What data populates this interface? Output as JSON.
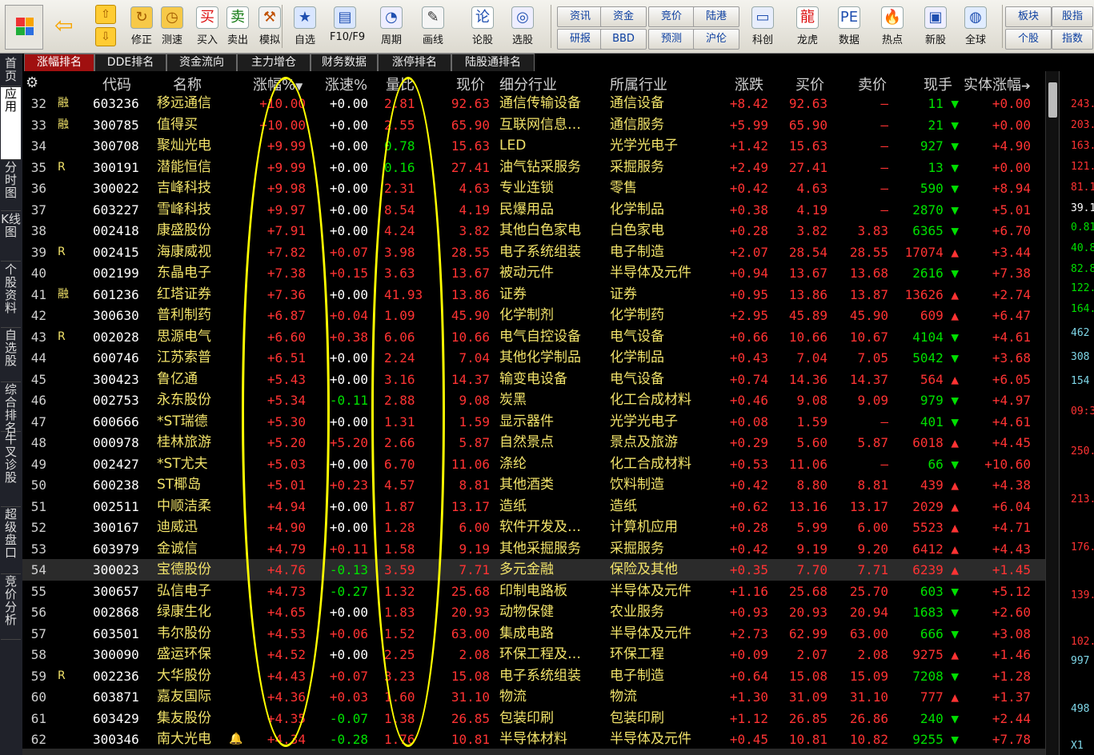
{
  "toolbar": {
    "buttons": [
      {
        "label": "修正",
        "icon": "refresh-icon"
      },
      {
        "label": "测速",
        "icon": "clock-icon"
      },
      {
        "label": "买入",
        "icon": "buy-icon"
      },
      {
        "label": "卖出",
        "icon": "sell-icon"
      },
      {
        "label": "模拟",
        "icon": "hammer-icon"
      },
      {
        "label": "自选",
        "icon": "star-icon"
      },
      {
        "label": "F10/F9",
        "icon": "f10-icon"
      },
      {
        "label": "周期",
        "icon": "cycle-icon"
      },
      {
        "label": "画线",
        "icon": "pencil-icon"
      },
      {
        "label": "论股",
        "icon": "discuss-icon"
      },
      {
        "label": "选股",
        "icon": "select-icon"
      },
      {
        "label": "科创",
        "icon": "chart-icon"
      },
      {
        "label": "龙虎",
        "icon": "dragon-icon"
      },
      {
        "label": "数据",
        "icon": "pe-icon"
      },
      {
        "label": "热点",
        "icon": "hot-icon"
      },
      {
        "label": "新股",
        "icon": "new-icon"
      },
      {
        "label": "全球",
        "icon": "globe-icon"
      }
    ],
    "small_buttons": [
      "资讯",
      "研报",
      "资金",
      "BBD",
      "竞价",
      "预测",
      "陆港",
      "沪伦",
      "板块",
      "个股",
      "股指",
      "指数"
    ]
  },
  "tabs": [
    "涨幅排名",
    "DDE排名",
    "资金流向",
    "主力增仓",
    "财务数据",
    "涨停排名",
    "陆股通排名"
  ],
  "leftbar": [
    "首页",
    "应用",
    "分时图",
    "K线图",
    "个股资料",
    "自选股",
    "综合排名",
    "牛叉诊股",
    "超级盘口",
    "竞价分析"
  ],
  "headers": [
    "",
    "代码",
    "名称",
    "涨幅%",
    "涨速%",
    "量比",
    "现价",
    "细分行业",
    "所属行业",
    "涨跌",
    "买价",
    "卖价",
    "现手",
    "实体涨幅"
  ],
  "rows": [
    {
      "no": "32",
      "flag": "融",
      "code": "603236",
      "name": "移远通信",
      "chg": "+10.00",
      "speed": "+0.00",
      "vol": "2.81",
      "price": "92.63",
      "sub": "通信传输设备",
      "ind": "通信设备",
      "diff": "+8.42",
      "bid": "92.63",
      "ask": "–",
      "hand": "11",
      "dir": "down",
      "body": "+0.00"
    },
    {
      "no": "33",
      "flag": "融",
      "code": "300785",
      "name": "值得买",
      "chg": "+10.00",
      "speed": "+0.00",
      "vol": "2.55",
      "price": "65.90",
      "sub": "互联网信息…",
      "ind": "通信服务",
      "diff": "+5.99",
      "bid": "65.90",
      "ask": "–",
      "hand": "21",
      "dir": "down",
      "body": "+0.00"
    },
    {
      "no": "34",
      "flag": "",
      "code": "300708",
      "name": "聚灿光电",
      "chg": "+9.99",
      "speed": "+0.00",
      "vol": "0.78",
      "price": "15.63",
      "sub": "LED",
      "ind": "光学光电子",
      "diff": "+1.42",
      "bid": "15.63",
      "ask": "–",
      "hand": "927",
      "dir": "down",
      "body": "+4.90"
    },
    {
      "no": "35",
      "flag": "R",
      "code": "300191",
      "name": "潜能恒信",
      "chg": "+9.99",
      "speed": "+0.00",
      "vol": "0.16",
      "price": "27.41",
      "sub": "油气钻采服务",
      "ind": "采掘服务",
      "diff": "+2.49",
      "bid": "27.41",
      "ask": "–",
      "hand": "13",
      "dir": "down",
      "body": "+0.00"
    },
    {
      "no": "36",
      "flag": "",
      "code": "300022",
      "name": "吉峰科技",
      "chg": "+9.98",
      "speed": "+0.00",
      "vol": "2.31",
      "price": "4.63",
      "sub": "专业连锁",
      "ind": "零售",
      "diff": "+0.42",
      "bid": "4.63",
      "ask": "–",
      "hand": "590",
      "dir": "down",
      "body": "+8.94"
    },
    {
      "no": "37",
      "flag": "",
      "code": "603227",
      "name": "雪峰科技",
      "chg": "+9.97",
      "speed": "+0.00",
      "vol": "8.54",
      "price": "4.19",
      "sub": "民爆用品",
      "ind": "化学制品",
      "diff": "+0.38",
      "bid": "4.19",
      "ask": "–",
      "hand": "2870",
      "dir": "down",
      "body": "+5.01"
    },
    {
      "no": "38",
      "flag": "",
      "code": "002418",
      "name": "康盛股份",
      "chg": "+7.91",
      "speed": "+0.00",
      "vol": "4.24",
      "price": "3.82",
      "sub": "其他白色家电",
      "ind": "白色家电",
      "diff": "+0.28",
      "bid": "3.82",
      "ask": "3.83",
      "hand": "6365",
      "dir": "down",
      "body": "+6.70"
    },
    {
      "no": "39",
      "flag": "R",
      "code": "002415",
      "name": "海康威视",
      "chg": "+7.82",
      "speed": "+0.07",
      "vol": "3.98",
      "price": "28.55",
      "sub": "电子系统组装",
      "ind": "电子制造",
      "diff": "+2.07",
      "bid": "28.54",
      "ask": "28.55",
      "hand": "17074",
      "dir": "up",
      "body": "+3.44"
    },
    {
      "no": "40",
      "flag": "",
      "code": "002199",
      "name": "东晶电子",
      "chg": "+7.38",
      "speed": "+0.15",
      "vol": "3.63",
      "price": "13.67",
      "sub": "被动元件",
      "ind": "半导体及元件",
      "diff": "+0.94",
      "bid": "13.67",
      "ask": "13.68",
      "hand": "2616",
      "dir": "down",
      "body": "+7.38"
    },
    {
      "no": "41",
      "flag": "融",
      "code": "601236",
      "name": "红塔证券",
      "chg": "+7.36",
      "speed": "+0.00",
      "vol": "41.93",
      "price": "13.86",
      "sub": "证券",
      "ind": "证券",
      "diff": "+0.95",
      "bid": "13.86",
      "ask": "13.87",
      "hand": "13626",
      "dir": "up",
      "body": "+2.74"
    },
    {
      "no": "42",
      "flag": "",
      "code": "300630",
      "name": "普利制药",
      "chg": "+6.87",
      "speed": "+0.04",
      "vol": "1.09",
      "price": "45.90",
      "sub": "化学制剂",
      "ind": "化学制药",
      "diff": "+2.95",
      "bid": "45.89",
      "ask": "45.90",
      "hand": "609",
      "dir": "up",
      "body": "+6.47"
    },
    {
      "no": "43",
      "flag": "R",
      "code": "002028",
      "name": "思源电气",
      "chg": "+6.60",
      "speed": "+0.38",
      "vol": "6.06",
      "price": "10.66",
      "sub": "电气自控设备",
      "ind": "电气设备",
      "diff": "+0.66",
      "bid": "10.66",
      "ask": "10.67",
      "hand": "4104",
      "dir": "down",
      "body": "+4.61"
    },
    {
      "no": "44",
      "flag": "",
      "code": "600746",
      "name": "江苏索普",
      "chg": "+6.51",
      "speed": "+0.00",
      "vol": "2.24",
      "price": "7.04",
      "sub": "其他化学制品",
      "ind": "化学制品",
      "diff": "+0.43",
      "bid": "7.04",
      "ask": "7.05",
      "hand": "5042",
      "dir": "down",
      "body": "+3.68"
    },
    {
      "no": "45",
      "flag": "",
      "code": "300423",
      "name": "鲁亿通",
      "chg": "+5.43",
      "speed": "+0.00",
      "vol": "3.16",
      "price": "14.37",
      "sub": "输变电设备",
      "ind": "电气设备",
      "diff": "+0.74",
      "bid": "14.36",
      "ask": "14.37",
      "hand": "564",
      "dir": "up",
      "body": "+6.05"
    },
    {
      "no": "46",
      "flag": "",
      "code": "002753",
      "name": "永东股份",
      "chg": "+5.34",
      "speed": "-0.11",
      "vol": "2.88",
      "price": "9.08",
      "sub": "炭黑",
      "ind": "化工合成材料",
      "diff": "+0.46",
      "bid": "9.08",
      "ask": "9.09",
      "hand": "979",
      "dir": "down",
      "body": "+4.97"
    },
    {
      "no": "47",
      "flag": "",
      "code": "600666",
      "name": "*ST瑞德",
      "chg": "+5.30",
      "speed": "+0.00",
      "vol": "1.31",
      "price": "1.59",
      "sub": "显示器件",
      "ind": "光学光电子",
      "diff": "+0.08",
      "bid": "1.59",
      "ask": "–",
      "hand": "401",
      "dir": "down",
      "body": "+4.61"
    },
    {
      "no": "48",
      "flag": "",
      "code": "000978",
      "name": "桂林旅游",
      "chg": "+5.20",
      "speed": "+5.20",
      "vol": "2.66",
      "price": "5.87",
      "sub": "自然景点",
      "ind": "景点及旅游",
      "diff": "+0.29",
      "bid": "5.60",
      "ask": "5.87",
      "hand": "6018",
      "dir": "up",
      "body": "+4.45"
    },
    {
      "no": "49",
      "flag": "",
      "code": "002427",
      "name": "*ST尤夫",
      "chg": "+5.03",
      "speed": "+0.00",
      "vol": "6.70",
      "price": "11.06",
      "sub": "涤纶",
      "ind": "化工合成材料",
      "diff": "+0.53",
      "bid": "11.06",
      "ask": "–",
      "hand": "66",
      "dir": "down",
      "body": "+10.60"
    },
    {
      "no": "50",
      "flag": "",
      "code": "600238",
      "name": "ST椰岛",
      "chg": "+5.01",
      "speed": "+0.23",
      "vol": "4.57",
      "price": "8.81",
      "sub": "其他酒类",
      "ind": "饮料制造",
      "diff": "+0.42",
      "bid": "8.80",
      "ask": "8.81",
      "hand": "439",
      "dir": "up",
      "body": "+4.38"
    },
    {
      "no": "51",
      "flag": "",
      "code": "002511",
      "name": "中顺洁柔",
      "chg": "+4.94",
      "speed": "+0.00",
      "vol": "1.87",
      "price": "13.17",
      "sub": "造纸",
      "ind": "造纸",
      "diff": "+0.62",
      "bid": "13.16",
      "ask": "13.17",
      "hand": "2029",
      "dir": "up",
      "body": "+6.04"
    },
    {
      "no": "52",
      "flag": "",
      "code": "300167",
      "name": "迪威迅",
      "chg": "+4.90",
      "speed": "+0.00",
      "vol": "1.28",
      "price": "6.00",
      "sub": "软件开发及…",
      "ind": "计算机应用",
      "diff": "+0.28",
      "bid": "5.99",
      "ask": "6.00",
      "hand": "5523",
      "dir": "up",
      "body": "+4.71"
    },
    {
      "no": "53",
      "flag": "",
      "code": "603979",
      "name": "金诚信",
      "chg": "+4.79",
      "speed": "+0.11",
      "vol": "1.58",
      "price": "9.19",
      "sub": "其他采掘服务",
      "ind": "采掘服务",
      "diff": "+0.42",
      "bid": "9.19",
      "ask": "9.20",
      "hand": "6412",
      "dir": "up",
      "body": "+4.43"
    },
    {
      "no": "54",
      "flag": "",
      "code": "300023",
      "name": "宝德股份",
      "chg": "+4.76",
      "speed": "-0.13",
      "vol": "3.59",
      "price": "7.71",
      "sub": "多元金融",
      "ind": "保险及其他",
      "diff": "+0.35",
      "bid": "7.70",
      "ask": "7.71",
      "hand": "6239",
      "dir": "up",
      "body": "+1.45"
    },
    {
      "no": "55",
      "flag": "",
      "code": "300657",
      "name": "弘信电子",
      "chg": "+4.73",
      "speed": "-0.27",
      "vol": "1.32",
      "price": "25.68",
      "sub": "印制电路板",
      "ind": "半导体及元件",
      "diff": "+1.16",
      "bid": "25.68",
      "ask": "25.70",
      "hand": "603",
      "dir": "down",
      "body": "+5.12"
    },
    {
      "no": "56",
      "flag": "",
      "code": "002868",
      "name": "绿康生化",
      "chg": "+4.65",
      "speed": "+0.00",
      "vol": "1.83",
      "price": "20.93",
      "sub": "动物保健",
      "ind": "农业服务",
      "diff": "+0.93",
      "bid": "20.93",
      "ask": "20.94",
      "hand": "1683",
      "dir": "down",
      "body": "+2.60"
    },
    {
      "no": "57",
      "flag": "",
      "code": "603501",
      "name": "韦尔股份",
      "chg": "+4.53",
      "speed": "+0.06",
      "vol": "1.52",
      "price": "63.00",
      "sub": "集成电路",
      "ind": "半导体及元件",
      "diff": "+2.73",
      "bid": "62.99",
      "ask": "63.00",
      "hand": "666",
      "dir": "down",
      "body": "+3.08"
    },
    {
      "no": "58",
      "flag": "",
      "code": "300090",
      "name": "盛运环保",
      "chg": "+4.52",
      "speed": "+0.00",
      "vol": "2.25",
      "price": "2.08",
      "sub": "环保工程及…",
      "ind": "环保工程",
      "diff": "+0.09",
      "bid": "2.07",
      "ask": "2.08",
      "hand": "9275",
      "dir": "up",
      "body": "+1.46"
    },
    {
      "no": "59",
      "flag": "R",
      "code": "002236",
      "name": "大华股份",
      "chg": "+4.43",
      "speed": "+0.07",
      "vol": "3.23",
      "price": "15.08",
      "sub": "电子系统组装",
      "ind": "电子制造",
      "diff": "+0.64",
      "bid": "15.08",
      "ask": "15.09",
      "hand": "7208",
      "dir": "down",
      "body": "+1.28"
    },
    {
      "no": "60",
      "flag": "",
      "code": "603871",
      "name": "嘉友国际",
      "chg": "+4.36",
      "speed": "+0.03",
      "vol": "1.60",
      "price": "31.10",
      "sub": "物流",
      "ind": "物流",
      "diff": "+1.30",
      "bid": "31.09",
      "ask": "31.10",
      "hand": "777",
      "dir": "up",
      "body": "+1.37"
    },
    {
      "no": "61",
      "flag": "",
      "code": "603429",
      "name": "集友股份",
      "chg": "+4.35",
      "speed": "-0.07",
      "vol": "1.38",
      "price": "26.85",
      "sub": "包装印刷",
      "ind": "包装印刷",
      "diff": "+1.12",
      "bid": "26.85",
      "ask": "26.86",
      "hand": "240",
      "dir": "down",
      "body": "+2.44"
    },
    {
      "no": "62",
      "flag": "",
      "code": "300346",
      "name": "南大光电",
      "chg": "+4.34",
      "speed": "-0.28",
      "vol": "1.76",
      "price": "10.81",
      "sub": "半导体材料",
      "ind": "半导体及元件",
      "diff": "+0.45",
      "bid": "10.81",
      "ask": "10.82",
      "hand": "9255",
      "dir": "down",
      "body": "+7.78"
    }
  ],
  "right_values": [
    {
      "v": "243.",
      "c": "#ff3333"
    },
    {
      "v": "203.",
      "c": "#ff3333"
    },
    {
      "v": "163.",
      "c": "#ff3333"
    },
    {
      "v": "121.",
      "c": "#ff3333"
    },
    {
      "v": "81.1",
      "c": "#ff3333"
    },
    {
      "v": "39.1",
      "c": "#ffffff"
    },
    {
      "v": "0.81",
      "c": "#00e000"
    },
    {
      "v": "40.8",
      "c": "#00e000"
    },
    {
      "v": "82.8",
      "c": "#00e000"
    },
    {
      "v": "122.",
      "c": "#00e000"
    },
    {
      "v": "164.",
      "c": "#00e000"
    },
    {
      "v": "462",
      "c": "#7fd7e8"
    },
    {
      "v": "308",
      "c": "#7fd7e8"
    },
    {
      "v": "154",
      "c": "#7fd7e8"
    },
    {
      "v": "09:3",
      "c": "#ff3333"
    },
    {
      "v": "250.",
      "c": "#ff3333"
    },
    {
      "v": "213.",
      "c": "#ff3333"
    },
    {
      "v": "176.",
      "c": "#ff3333"
    },
    {
      "v": "139.",
      "c": "#ff3333"
    },
    {
      "v": "102.",
      "c": "#ff3333"
    },
    {
      "v": "997",
      "c": "#7fd7e8"
    },
    {
      "v": "498",
      "c": "#7fd7e8"
    },
    {
      "v": "X1",
      "c": "#7fd7e8"
    }
  ],
  "colors": {
    "up": "#ff3333",
    "down": "#00e000",
    "name": "#f2e36a",
    "highlight": "#ffff00",
    "tab_active": "#a01010"
  }
}
